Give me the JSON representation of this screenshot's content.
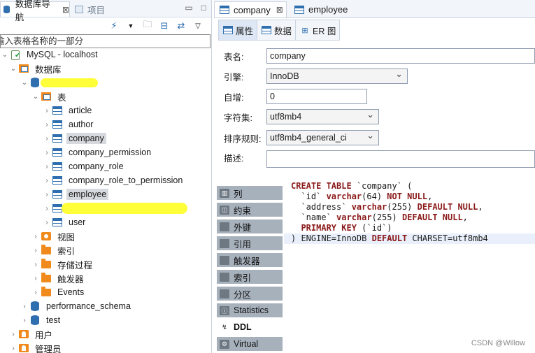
{
  "left_pane": {
    "tabs": [
      {
        "label": "数据库导航",
        "close": "⊠"
      },
      {
        "label": "项目"
      }
    ],
    "filter_placeholder": "输入表格名称的一部分",
    "tree": [
      {
        "label": "MySQL - localhost",
        "icon": "mysql-connection-icon",
        "depth": 0,
        "expanded": true
      },
      {
        "label": "数据库",
        "icon": "databases-folder-icon",
        "depth": 1,
        "expanded": true
      },
      {
        "label": "",
        "icon": "database-icon",
        "depth": 2,
        "expanded": true,
        "redacted": true
      },
      {
        "label": "表",
        "icon": "tables-folder-icon",
        "depth": 3,
        "expanded": true
      },
      {
        "label": "article",
        "icon": "table-icon",
        "depth": 4
      },
      {
        "label": "author",
        "icon": "table-icon",
        "depth": 4
      },
      {
        "label": "company",
        "icon": "table-icon",
        "depth": 4,
        "selected": true
      },
      {
        "label": "company_permission",
        "icon": "table-icon",
        "depth": 4
      },
      {
        "label": "company_role",
        "icon": "table-icon",
        "depth": 4
      },
      {
        "label": "company_role_to_permission",
        "icon": "table-icon",
        "depth": 4
      },
      {
        "label": "employee",
        "icon": "table-icon",
        "depth": 4,
        "selected": true
      },
      {
        "label": "",
        "icon": "table-icon",
        "depth": 4,
        "redacted": true
      },
      {
        "label": "user",
        "icon": "table-icon",
        "depth": 4
      },
      {
        "label": "视图",
        "icon": "views-folder-icon",
        "depth": 3
      },
      {
        "label": "索引",
        "icon": "folder-icon",
        "depth": 3
      },
      {
        "label": "存储过程",
        "icon": "folder-icon",
        "depth": 3
      },
      {
        "label": "触发器",
        "icon": "folder-icon",
        "depth": 3
      },
      {
        "label": "Events",
        "icon": "folder-icon",
        "depth": 3
      },
      {
        "label": "performance_schema",
        "icon": "database-icon",
        "depth": 2
      },
      {
        "label": "test",
        "icon": "database-icon",
        "depth": 2
      },
      {
        "label": "用户",
        "icon": "users-folder-icon",
        "depth": 1
      },
      {
        "label": "管理员",
        "icon": "admin-folder-icon",
        "depth": 1
      }
    ]
  },
  "editor": {
    "tabs": [
      {
        "label": "company",
        "close": "⊠"
      },
      {
        "label": "employee"
      }
    ],
    "subtabs": [
      {
        "label": "属性",
        "icon": "properties-icon"
      },
      {
        "label": "数据",
        "icon": "data-icon"
      },
      {
        "label": "ER 图",
        "icon": "er-diagram-icon"
      }
    ],
    "properties": {
      "name_label": "表名:",
      "name_value": "company",
      "engine_label": "引擎:",
      "engine_value": "InnoDB",
      "autoinc_label": "自增:",
      "autoinc_value": "0",
      "charset_label": "字符集:",
      "charset_value": "utf8mb4",
      "collation_label": "排序规则:",
      "collation_value": "utf8mb4_general_ci",
      "desc_label": "描述:",
      "desc_value": ""
    },
    "side_buttons": [
      {
        "label": "列",
        "icon": "columns-icon"
      },
      {
        "label": "约束",
        "icon": "constraints-icon"
      },
      {
        "label": "外键",
        "icon": "foreign-keys-icon"
      },
      {
        "label": "引用",
        "icon": "references-icon"
      },
      {
        "label": "触发器",
        "icon": "triggers-icon"
      },
      {
        "label": "索引",
        "icon": "indexes-icon"
      },
      {
        "label": "分区",
        "icon": "partitions-icon"
      },
      {
        "label": "Statistics",
        "icon": "statistics-icon"
      },
      {
        "label": "DDL",
        "icon": "ddl-icon",
        "active": true
      },
      {
        "label": "Virtual",
        "icon": "virtual-icon"
      }
    ],
    "ddl_lines": [
      "CREATE TABLE `company` (",
      "  `id` varchar(64) NOT NULL,",
      "  `address` varchar(255) DEFAULT NULL,",
      "  `name` varchar(255) DEFAULT NULL,",
      "  PRIMARY KEY (`id`)",
      ") ENGINE=InnoDB DEFAULT CHARSET=utf8mb4"
    ]
  },
  "watermark": "CSDN @Willow",
  "colors": {
    "accent": "#2f6fb0",
    "folder": "#f08a1c",
    "keyword": "#8b1a1a",
    "highlight": "#ffff2e"
  }
}
